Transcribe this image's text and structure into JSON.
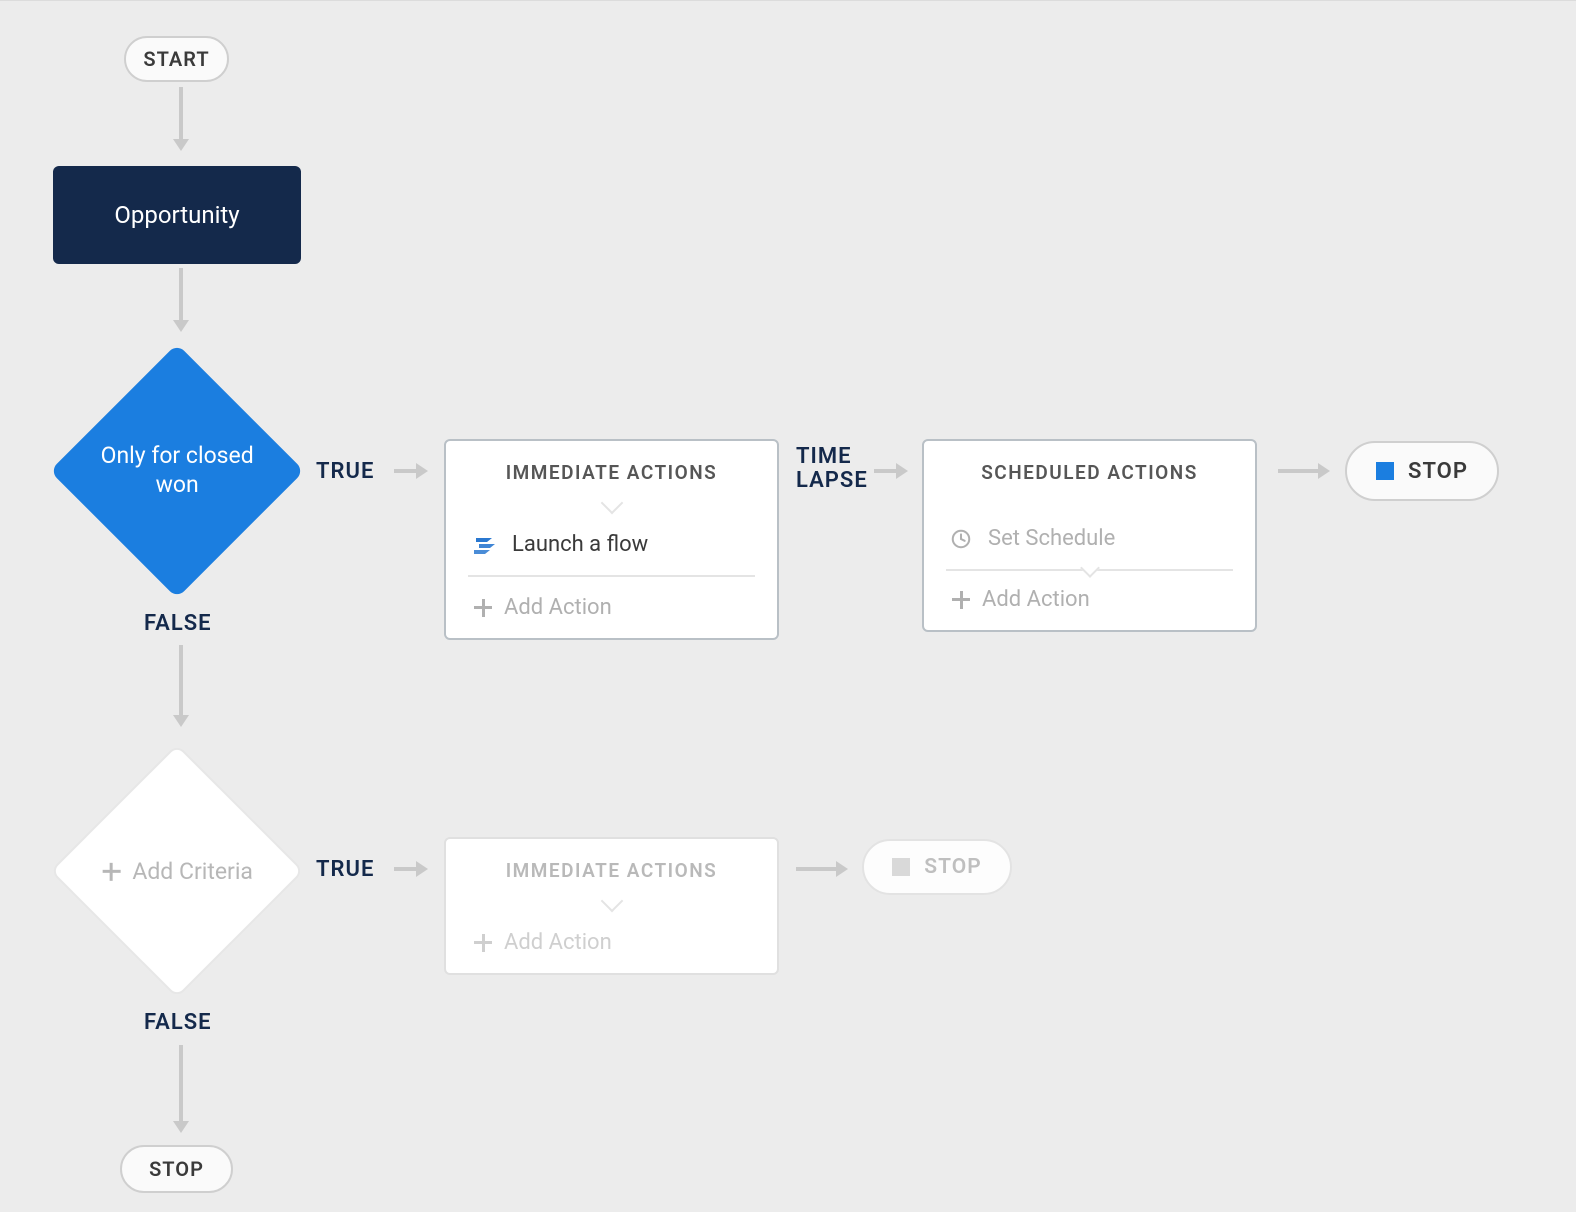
{
  "start_label": "START",
  "object_label": "Opportunity",
  "criteria1_label": "Only for closed won",
  "criteria2_label": "Add Criteria",
  "true_label": "TRUE",
  "false_label": "FALSE",
  "timelapse_line1": "TIME",
  "timelapse_line2": "LAPSE",
  "stop_label": "STOP",
  "immediate_actions_title": "IMMEDIATE ACTIONS",
  "scheduled_actions_title": "SCHEDULED ACTIONS",
  "action_launch_flow": "Launch a flow",
  "add_action_label": "Add Action",
  "set_schedule_label": "Set Schedule"
}
